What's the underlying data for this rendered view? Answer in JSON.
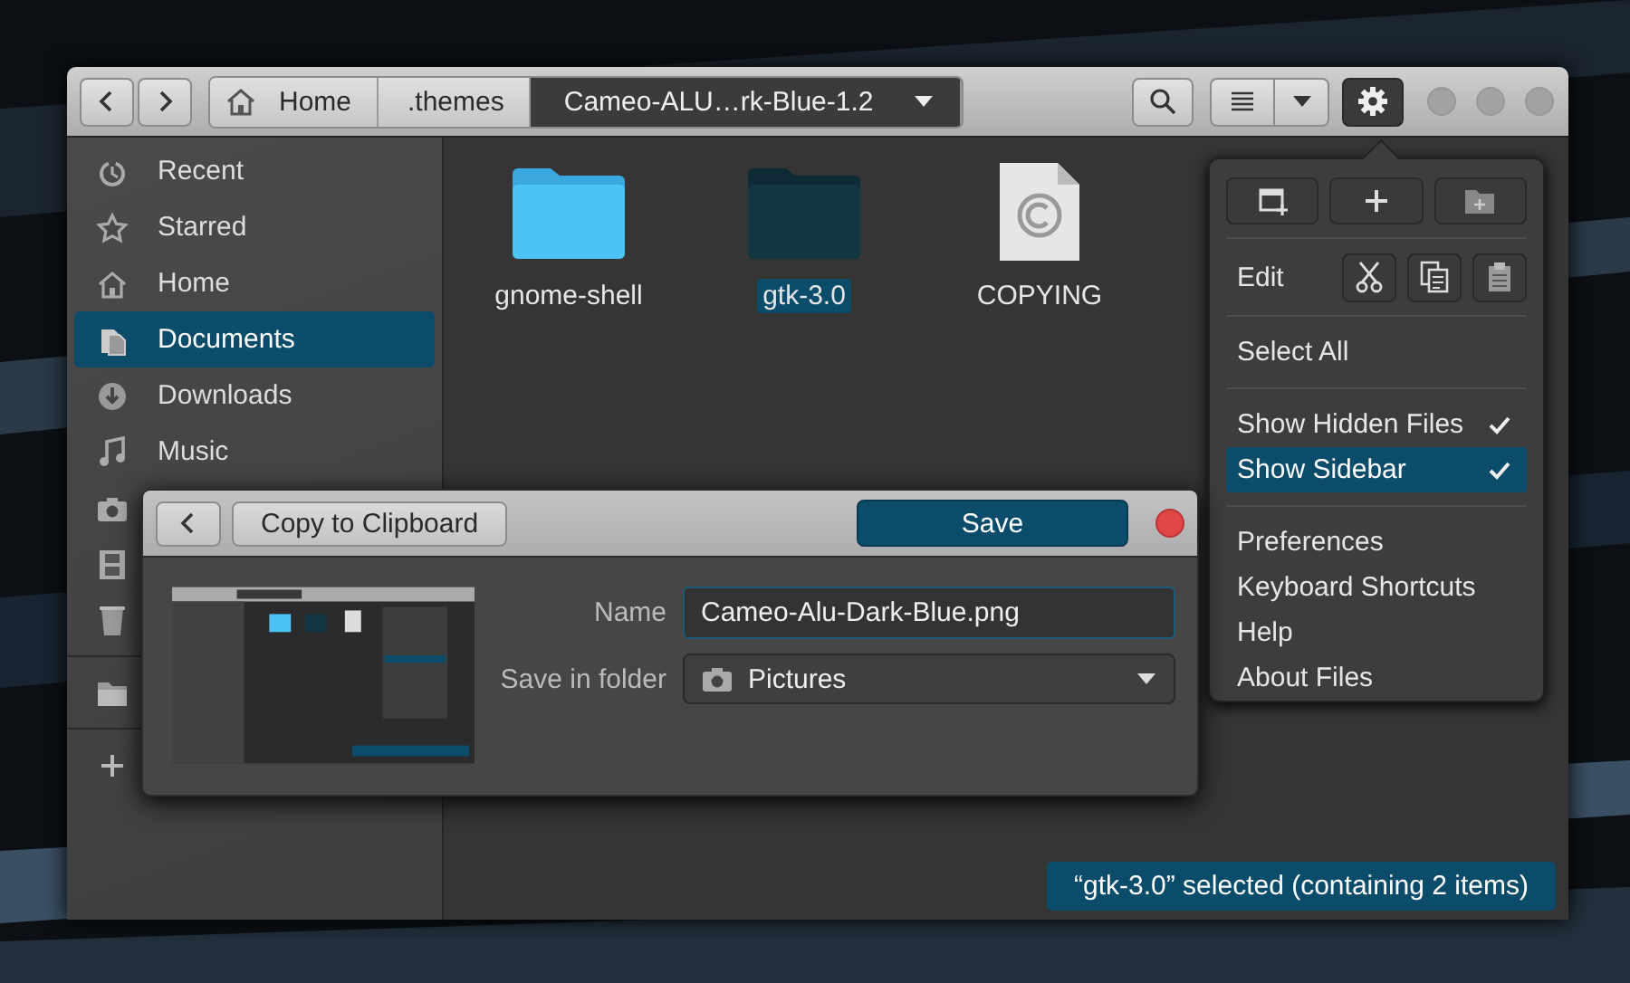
{
  "header": {
    "path": [
      {
        "label": "Home",
        "selected": false
      },
      {
        "label": ".themes",
        "selected": false
      },
      {
        "label": "Cameo-ALU…rk-Blue-1.2",
        "selected": true
      }
    ],
    "menu_button": {
      "active": true
    }
  },
  "sidebar": {
    "items": [
      {
        "label": "Recent",
        "selected": false
      },
      {
        "label": "Starred",
        "selected": false
      },
      {
        "label": "Home",
        "selected": false
      },
      {
        "label": "Documents",
        "selected": true
      },
      {
        "label": "Downloads",
        "selected": false
      },
      {
        "label": "Music",
        "selected": false
      },
      {
        "selected": false
      },
      {
        "selected": false
      },
      {
        "selected": false
      },
      {
        "selected": false
      },
      {
        "selected": false
      }
    ]
  },
  "files": [
    {
      "name": "gnome-shell",
      "kind": "folder",
      "selected": false
    },
    {
      "name": "gtk-3.0",
      "kind": "folder",
      "selected": true
    },
    {
      "name": "COPYING",
      "kind": "document",
      "selected": false
    }
  ],
  "menu": {
    "edit_label": "Edit",
    "sections": [
      [
        {
          "label": "Select All",
          "kind": "plain",
          "selected": false
        }
      ],
      [
        {
          "label": "Show Hidden Files",
          "kind": "check",
          "checked": true,
          "selected": false
        },
        {
          "label": "Show Sidebar",
          "kind": "check",
          "checked": true,
          "selected": true
        }
      ],
      [
        {
          "label": "Preferences",
          "kind": "plain",
          "selected": false
        },
        {
          "label": "Keyboard Shortcuts",
          "kind": "plain",
          "selected": false
        },
        {
          "label": "Help",
          "kind": "plain",
          "selected": false
        },
        {
          "label": "About Files",
          "kind": "plain",
          "selected": false
        }
      ]
    ]
  },
  "dialog": {
    "copy_button": "Copy to Clipboard",
    "save_button": "Save",
    "name_label": "Name",
    "name_value": "Cameo-Alu-Dark-Blue.png",
    "folder_label": "Save in folder",
    "folder_value": "Pictures"
  },
  "status_bar": "“gtk-3.0” selected (containing 2 items)"
}
